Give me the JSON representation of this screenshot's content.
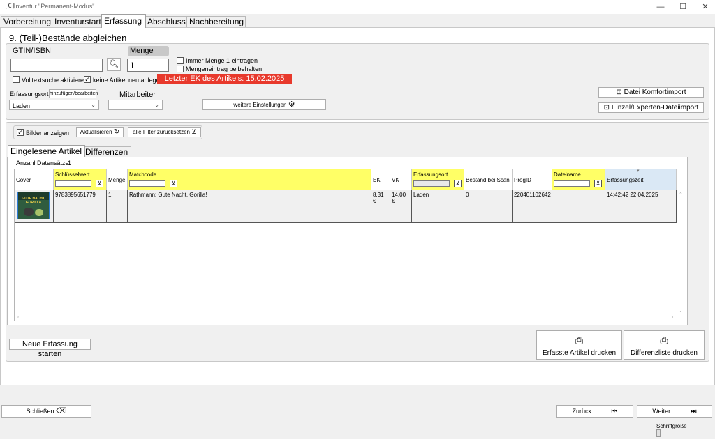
{
  "window": {
    "title": "Inventur \"Permanent-Modus\""
  },
  "tabs": [
    {
      "label": "Vorbereitung"
    },
    {
      "label": "Inventurstart"
    },
    {
      "label": "Erfassung"
    },
    {
      "label": "Abschluss"
    },
    {
      "label": "Nachbereitung"
    }
  ],
  "section_title": "9. (Teil-)Bestände abgleichen",
  "gtin": {
    "label": "GTIN/ISBN",
    "value": ""
  },
  "menge": {
    "label": "Menge",
    "value": "1"
  },
  "options": {
    "immer_menge": "Immer Menge 1 eintragen",
    "mengeneintrag": "Mengeneintrag beibehalten",
    "volltext": "Volltextsuche aktivieren",
    "keine_artikel": "keine Artikel neu anlegen"
  },
  "last_ek": "Letzter EK des Artikels: 15.02.2025",
  "erfassungsort": {
    "label": "Erfassungsort:",
    "edit_button": "hinzufügen/bearbeiten",
    "value": "Laden"
  },
  "mitarbeiter": {
    "label": "Mitarbeiter",
    "value": ""
  },
  "weitere_einstellungen": "weitere Einstellungen",
  "import": {
    "komfort": "Datei Komfortimport",
    "experten": "Einzel/Experten-Dateiimport"
  },
  "toolbar": {
    "bilder_anzeigen": "Bilder anzeigen",
    "aktualisieren": "Aktualisieren",
    "filter_reset": "alle Filter zurücksetzen"
  },
  "subtabs": [
    {
      "label": "Eingelesene Artikel"
    },
    {
      "label": "Differenzen"
    }
  ],
  "record_count": {
    "label": "Anzahl Datensätze:",
    "value": "1"
  },
  "columns": {
    "cover": "Cover",
    "schluesselwert": "Schlüsselwert",
    "menge": "Menge",
    "matchcode": "Matchcode",
    "ek": "EK",
    "vk": "VK",
    "erfassungsort": "Erfassungsort",
    "bestand": "Bestand bei Scan",
    "progid": "ProgID",
    "dateiname": "Dateiname",
    "erfassungszeit": "Erfassungszeit"
  },
  "rows": [
    {
      "cover_title": "GUTE NACHT, GORILLA",
      "schluesselwert": "9783895651779",
      "menge": "1",
      "matchcode": "Rathmann; Gute Nacht, Gorilla!",
      "ek": "8,31 €",
      "vk": "14,00 €",
      "erfassungsort": "Laden",
      "bestand": "0",
      "progid": "220401102642",
      "dateiname": "",
      "erfassungszeit": "14:42:42 22.04.2025"
    }
  ],
  "neue_erfassung": "Neue Erfassung starten",
  "print": {
    "erfasste": "Erfasste Artikel drucken",
    "differenz": "Differenzliste drucken"
  },
  "footer": {
    "schliessen": "Schließen",
    "zurueck": "Zurück",
    "weiter": "Weiter",
    "schriftgroesse": "Schriftgröße"
  },
  "colors": {
    "accent_red": "#e8392c",
    "filter_yellow": "#ffff66",
    "header_blue": "#dae8f5"
  }
}
